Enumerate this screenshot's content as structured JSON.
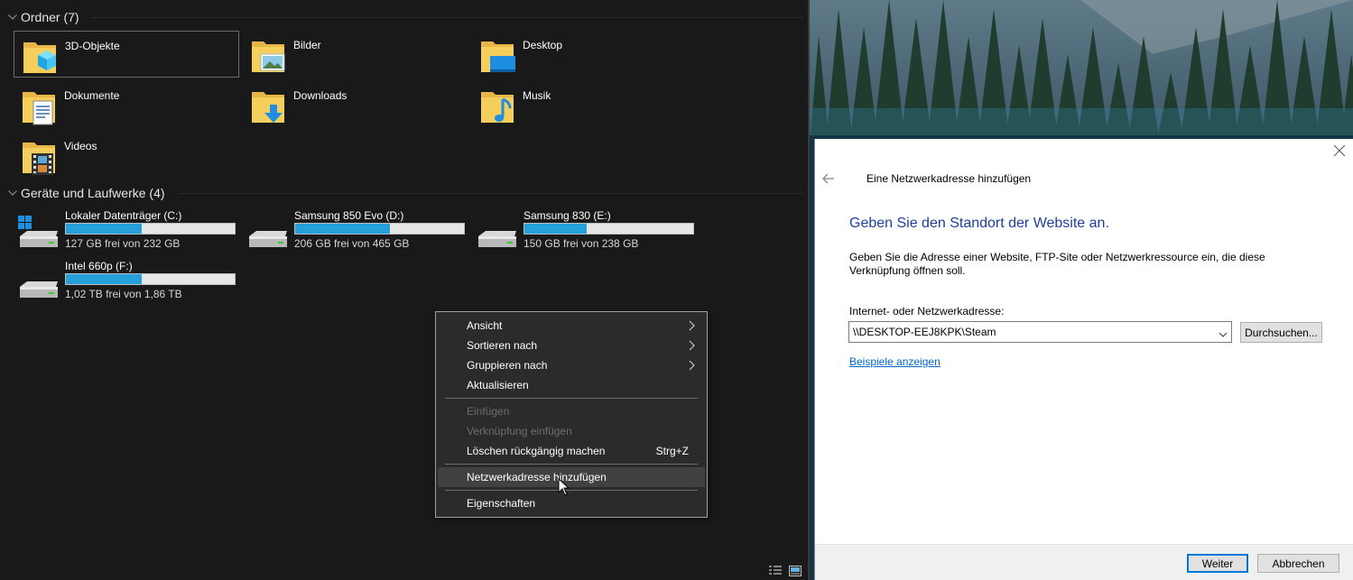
{
  "explorer": {
    "folders_header": "Ordner (7)",
    "folders": [
      {
        "name": "3D-Objekte",
        "icon": "3d-objects-folder-icon",
        "selected": true
      },
      {
        "name": "Bilder",
        "icon": "pictures-folder-icon"
      },
      {
        "name": "Desktop",
        "icon": "desktop-folder-icon"
      },
      {
        "name": "Dokumente",
        "icon": "documents-folder-icon"
      },
      {
        "name": "Downloads",
        "icon": "downloads-folder-icon"
      },
      {
        "name": "Musik",
        "icon": "music-folder-icon"
      },
      {
        "name": "Videos",
        "icon": "videos-folder-icon"
      }
    ],
    "drives_header": "Geräte und Laufwerke (4)",
    "drives": [
      {
        "name": "Lokaler Datenträger (C:)",
        "free": "127 GB frei von 232 GB",
        "used_fraction": 0.45,
        "icon": "system-drive-icon"
      },
      {
        "name": "Samsung 850 Evo (D:)",
        "free": "206 GB frei von 465 GB",
        "used_fraction": 0.56,
        "icon": "drive-icon"
      },
      {
        "name": "Samsung 830 (E:)",
        "free": "150 GB frei von 238 GB",
        "used_fraction": 0.37,
        "icon": "drive-icon"
      },
      {
        "name": "Intel 660p (F:)",
        "free": "1,02 TB frei von 1,86 TB",
        "used_fraction": 0.45,
        "icon": "drive-icon"
      }
    ],
    "bar_color": "#26a0da"
  },
  "context_menu": {
    "items": [
      {
        "label": "Ansicht",
        "submenu": true
      },
      {
        "label": "Sortieren nach",
        "submenu": true
      },
      {
        "label": "Gruppieren nach",
        "submenu": true
      },
      {
        "label": "Aktualisieren"
      },
      {
        "label": "Einfügen",
        "disabled": true
      },
      {
        "label": "Verknüpfung einfügen",
        "disabled": true
      },
      {
        "label": "Löschen rückgängig machen",
        "shortcut": "Strg+Z"
      },
      {
        "label": "Netzwerkadresse hinzufügen",
        "highlighted": true
      },
      {
        "label": "Eigenschaften"
      }
    ]
  },
  "wizard": {
    "title": "Eine Netzwerkadresse hinzufügen",
    "heading": "Geben Sie den Standort der Website an.",
    "description": "Geben Sie die Adresse einer Website, FTP-Site oder Netzwerkressource ein, die diese Verknüpfung öffnen soll.",
    "field_label": "Internet- oder Netzwerkadresse:",
    "address_value": "\\\\DESKTOP-EEJ8KPK\\Steam",
    "browse_label": "Durchsuchen...",
    "examples_link": "Beispiele anzeigen",
    "next_label": "Weiter",
    "cancel_label": "Abbrechen",
    "heading_color": "#1c3f99",
    "link_color": "#0066cc"
  }
}
